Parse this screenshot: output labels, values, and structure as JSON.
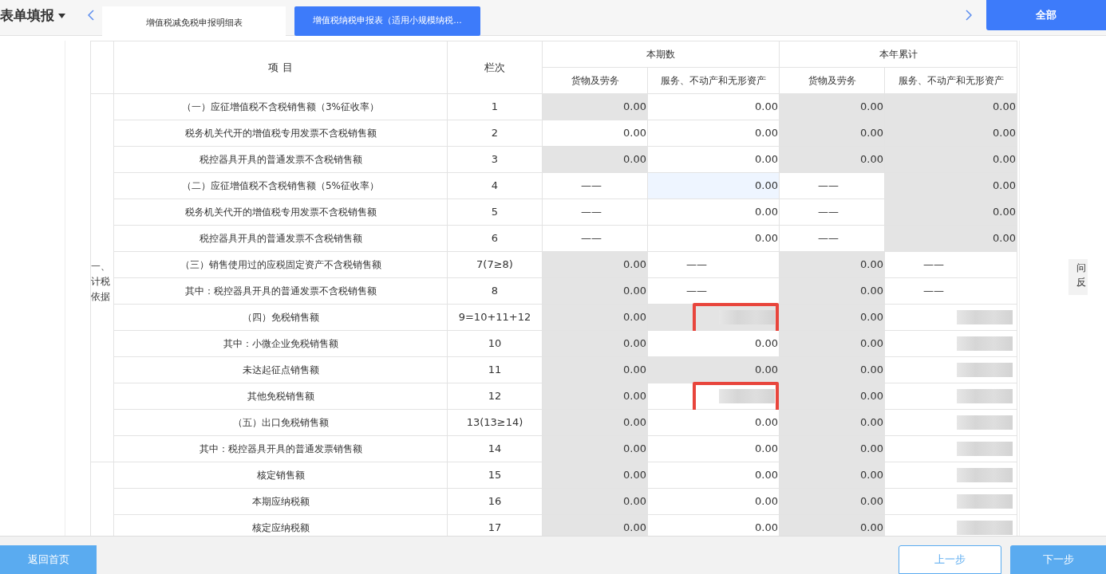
{
  "header": {
    "title": "表单填报",
    "tabs": [
      {
        "label": "增值税减免税申报明细表",
        "selected": false
      },
      {
        "label": "增值税纳税申报表（适用小规模纳税...",
        "selected": true
      }
    ],
    "all_button": "全部"
  },
  "table": {
    "columns": {
      "item": "项 目",
      "line": "栏次",
      "group_1": "本期数",
      "group_2": "本年累计",
      "sub": [
        "货物及劳务",
        "服务、不动产和无形资产",
        "货物及劳务",
        "服务、不动产和无形资产"
      ]
    },
    "sections": [
      {
        "label": "一、计税依据",
        "rows": [
          {
            "item": "（一）应征增值税不含税销售额（3%征收率）",
            "line": "1",
            "cells": [
              {
                "value": "0.00",
                "shaded": true
              },
              {
                "value": "0.00",
                "shaded": false
              },
              {
                "value": "0.00",
                "shaded": true
              },
              {
                "value": "0.00",
                "shaded": true
              }
            ]
          },
          {
            "item": "税务机关代开的增值税专用发票不含税销售额",
            "line": "2",
            "cells": [
              {
                "value": "0.00",
                "shaded": false
              },
              {
                "value": "0.00",
                "shaded": false
              },
              {
                "value": "0.00",
                "shaded": true
              },
              {
                "value": "0.00",
                "shaded": true
              }
            ]
          },
          {
            "item": "税控器具开具的普通发票不含税销售额",
            "line": "3",
            "cells": [
              {
                "value": "0.00",
                "shaded": true
              },
              {
                "value": "0.00",
                "shaded": false
              },
              {
                "value": "0.00",
                "shaded": true
              },
              {
                "value": "0.00",
                "shaded": true
              }
            ]
          },
          {
            "item": "（二）应征增值税不含税销售额（5%征收率）",
            "line": "4",
            "cells": [
              {
                "value": "——",
                "shaded": false
              },
              {
                "value": "0.00",
                "shaded": false,
                "focused": true
              },
              {
                "value": "——",
                "shaded": false
              },
              {
                "value": "0.00",
                "shaded": true
              }
            ]
          },
          {
            "item": "税务机关代开的增值税专用发票不含税销售额",
            "line": "5",
            "cells": [
              {
                "value": "——",
                "shaded": false
              },
              {
                "value": "0.00",
                "shaded": false
              },
              {
                "value": "——",
                "shaded": false
              },
              {
                "value": "0.00",
                "shaded": true
              }
            ]
          },
          {
            "item": "税控器具开具的普通发票不含税销售额",
            "line": "6",
            "cells": [
              {
                "value": "——",
                "shaded": false
              },
              {
                "value": "0.00",
                "shaded": false
              },
              {
                "value": "——",
                "shaded": false
              },
              {
                "value": "0.00",
                "shaded": true
              }
            ]
          },
          {
            "item": "（三）销售使用过的应税固定资产不含税销售额",
            "line": "7(7≥8)",
            "cells": [
              {
                "value": "0.00",
                "shaded": true
              },
              {
                "value": "——",
                "shaded": false
              },
              {
                "value": "0.00",
                "shaded": true
              },
              {
                "value": "——",
                "shaded": false
              }
            ]
          },
          {
            "item": "其中：税控器具开具的普通发票不含税销售额",
            "line": "8",
            "cells": [
              {
                "value": "0.00",
                "shaded": true
              },
              {
                "value": "——",
                "shaded": false
              },
              {
                "value": "0.00",
                "shaded": true
              },
              {
                "value": "——",
                "shaded": false
              }
            ]
          },
          {
            "item": "（四）免税销售额",
            "line": "9=10+11+12",
            "cells": [
              {
                "value": "0.00",
                "shaded": true
              },
              {
                "kind": "redacted",
                "shaded": true,
                "marked": true
              },
              {
                "value": "0.00",
                "shaded": true
              },
              {
                "kind": "redacted",
                "shaded": false
              }
            ]
          },
          {
            "item": "其中：小微企业免税销售额",
            "line": "10",
            "cells": [
              {
                "value": "0.00",
                "shaded": true
              },
              {
                "value": "0.00",
                "shaded": false
              },
              {
                "value": "0.00",
                "shaded": true
              },
              {
                "kind": "redacted",
                "shaded": false
              }
            ]
          },
          {
            "item": "未达起征点销售额",
            "line": "11",
            "cells": [
              {
                "value": "0.00",
                "shaded": true
              },
              {
                "value": "0.00",
                "shaded": true
              },
              {
                "value": "0.00",
                "shaded": true
              },
              {
                "kind": "redacted",
                "shaded": false
              }
            ]
          },
          {
            "item": "其他免税销售额",
            "line": "12",
            "cells": [
              {
                "value": "0.00",
                "shaded": true
              },
              {
                "kind": "redacted",
                "shaded": false,
                "marked": true
              },
              {
                "value": "0.00",
                "shaded": true
              },
              {
                "kind": "redacted",
                "shaded": false
              }
            ]
          },
          {
            "item": "（五）出口免税销售额",
            "line": "13(13≥14)",
            "cells": [
              {
                "value": "0.00",
                "shaded": true
              },
              {
                "value": "0.00",
                "shaded": false
              },
              {
                "value": "0.00",
                "shaded": true
              },
              {
                "kind": "redacted",
                "shaded": false
              }
            ]
          },
          {
            "item": "其中：税控器具开具的普通发票销售额",
            "line": "14",
            "cells": [
              {
                "value": "0.00",
                "shaded": true
              },
              {
                "value": "0.00",
                "shaded": false
              },
              {
                "value": "0.00",
                "shaded": true
              },
              {
                "kind": "redacted",
                "shaded": false
              }
            ]
          }
        ]
      },
      {
        "rows": [
          {
            "item": "核定销售额",
            "line": "15",
            "cells": [
              {
                "value": "0.00",
                "shaded": true
              },
              {
                "value": "0.00",
                "shaded": false
              },
              {
                "value": "0.00",
                "shaded": true
              },
              {
                "kind": "redacted",
                "shaded": false
              }
            ]
          },
          {
            "item": "本期应纳税额",
            "line": "16",
            "cells": [
              {
                "value": "0.00",
                "shaded": true
              },
              {
                "value": "0.00",
                "shaded": false
              },
              {
                "value": "0.00",
                "shaded": true
              },
              {
                "kind": "redacted",
                "shaded": false
              }
            ]
          },
          {
            "item": "核定应纳税额",
            "line": "17",
            "cells": [
              {
                "value": "0.00",
                "shaded": true
              },
              {
                "value": "0.00",
                "shaded": false
              },
              {
                "value": "0.00",
                "shaded": true
              },
              {
                "kind": "redacted",
                "shaded": false
              }
            ]
          }
        ]
      }
    ]
  },
  "side_tab": "问反",
  "footer": {
    "home": "返回首页",
    "prev": "上一步",
    "next": "下一步"
  }
}
